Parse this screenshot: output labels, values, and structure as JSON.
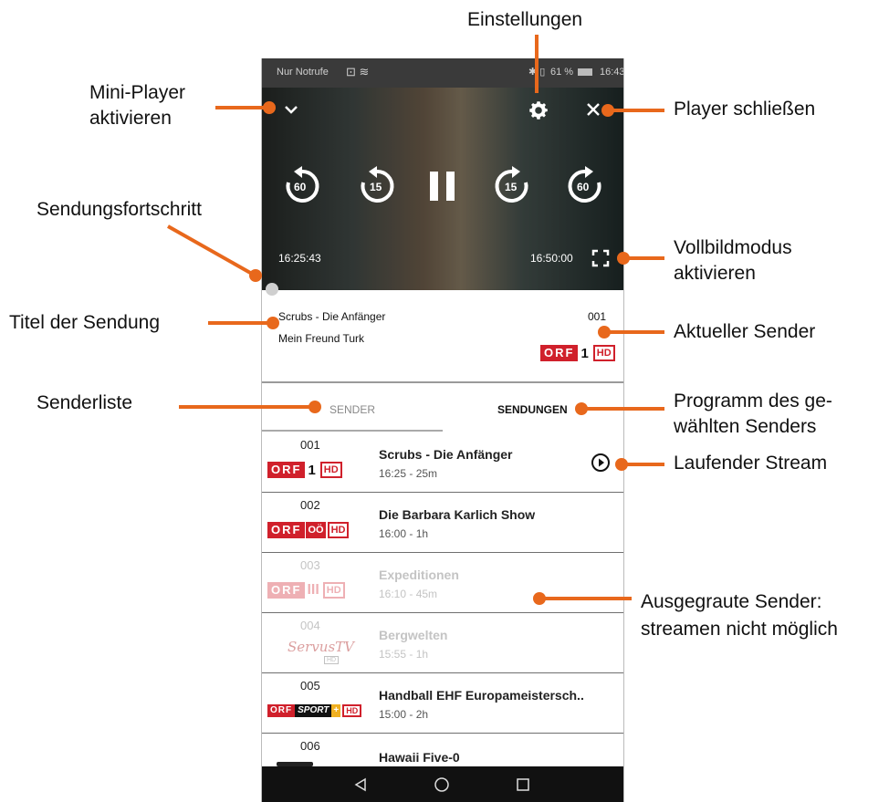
{
  "status_bar": {
    "left": "Nur Notrufe",
    "battery": "61 %",
    "time": "16:43"
  },
  "player": {
    "time_start": "16:25:43",
    "time_end": "16:50:00",
    "skip_back_60": "60",
    "skip_back_15": "15",
    "skip_fwd_15": "15",
    "skip_fwd_60": "60"
  },
  "now_playing": {
    "title": "Scrubs - Die Anfänger",
    "episode": "Mein Freund Turk",
    "channel_number": "001",
    "channel_logo_text": "ORF",
    "channel_logo_mark": "1",
    "channel_logo_hd": "HD"
  },
  "tabs": {
    "sender": "SENDER",
    "sendungen": "SENDUNGEN"
  },
  "channels": [
    {
      "number": "001",
      "logo": "ORF",
      "mark": "1",
      "hd": "HD",
      "title": "Scrubs - Die Anfänger",
      "time": "16:25 - 25m"
    },
    {
      "number": "002",
      "logo": "ORF",
      "mark": "OÖ",
      "hd": "HD",
      "title": "Die Barbara Karlich Show",
      "time": "16:00 - 1h"
    },
    {
      "number": "003",
      "logo": "ORF",
      "mark": "III",
      "hd": "HD",
      "title": "Expeditionen",
      "time": "16:10 - 45m"
    },
    {
      "number": "004",
      "logo": "ServusTV",
      "mark": "",
      "hd": "HD",
      "title": "Bergwelten",
      "time": "15:55 - 1h"
    },
    {
      "number": "005",
      "logo": "ORF",
      "mark": "SPORT",
      "mark2": "+",
      "hd": "HD",
      "title": "Handball EHF Europameistersch..",
      "time": "15:00 - 2h"
    },
    {
      "number": "006",
      "logo": "",
      "mark": "",
      "hd": "",
      "title": "Hawaii Five-0",
      "time": ""
    }
  ],
  "annotations": {
    "settings": "Einstellungen",
    "mini_player_1": "Mini-Player",
    "mini_player_2": "aktivieren",
    "close_player": "Player schließen",
    "progress": "Sendungsfortschritt",
    "fullscreen_1": "Vollbildmodus",
    "fullscreen_2": "aktivieren",
    "title": "Titel der Sendung",
    "current_channel": "Aktueller Sender",
    "channel_list": "Senderliste",
    "program_1": "Programm des ge-",
    "program_2": "wählten Senders",
    "running_stream": "Laufender Stream",
    "greyed_1": "Ausgegraute Sender:",
    "greyed_2": "streamen nicht möglich"
  },
  "colors": {
    "accent": "#e8681c",
    "orf_red": "#d0202b"
  }
}
